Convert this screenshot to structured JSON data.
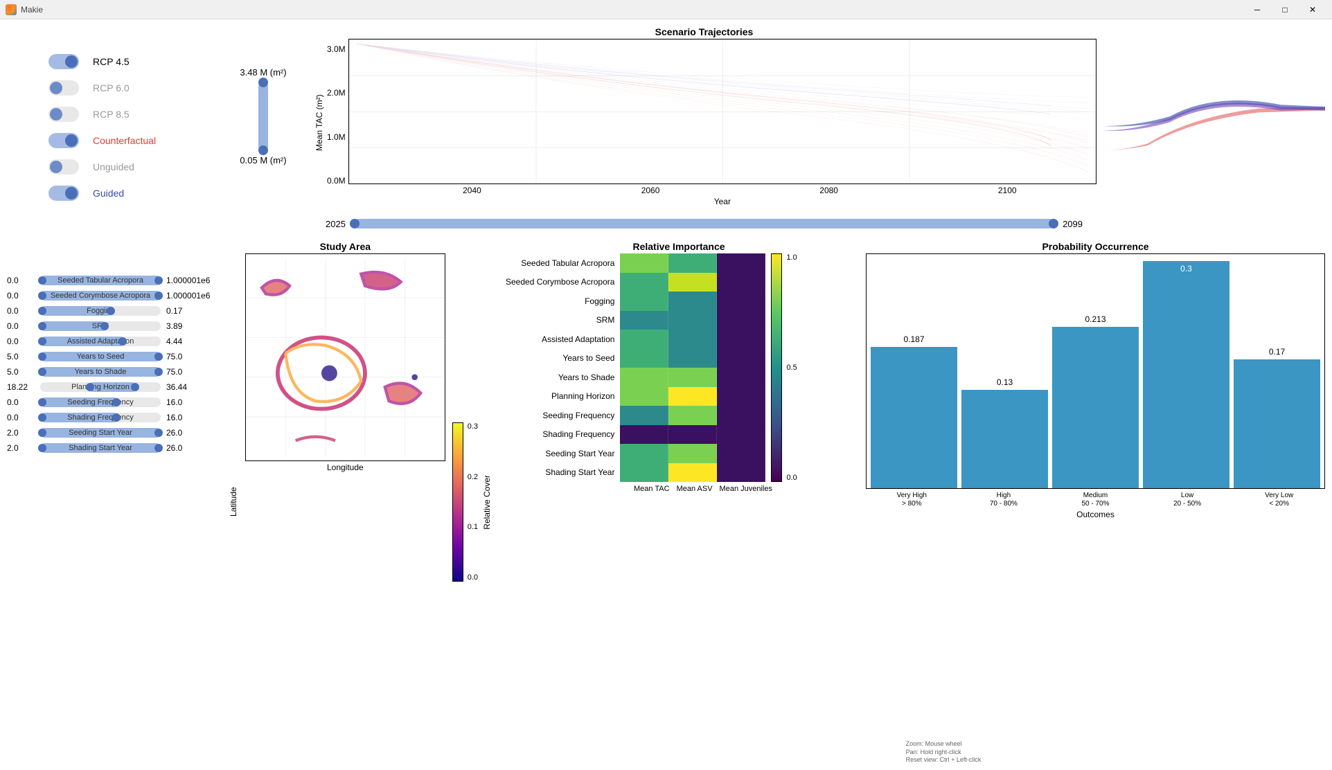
{
  "app": {
    "title": "Makie"
  },
  "toggles": [
    {
      "name": "rcp45",
      "label": "RCP 4.5",
      "on": true,
      "class": ""
    },
    {
      "name": "rcp60",
      "label": "RCP 6.0",
      "on": false,
      "class": "inactive"
    },
    {
      "name": "rcp85",
      "label": "RCP 8.5",
      "on": false,
      "class": "inactive"
    },
    {
      "name": "counterfactual",
      "label": "Counterfactual",
      "on": true,
      "class": "active-red"
    },
    {
      "name": "unguided",
      "label": "Unguided",
      "on": false,
      "class": "inactive"
    },
    {
      "name": "guided",
      "label": "Guided",
      "on": true,
      "class": "active-blue"
    }
  ],
  "vslider": {
    "top_label": "3.48 M (m²)",
    "bot_label": "0.05 M (m²)"
  },
  "year_slider": {
    "min": "2025",
    "max": "2099"
  },
  "params": [
    {
      "name": "Seeded Tabular Acropora",
      "min": "0.0",
      "max": "1.000001e6",
      "fill_l": 0,
      "fill_w": 100
    },
    {
      "name": "Seeded Corymbose Acropora",
      "min": "0.0",
      "max": "1.000001e6",
      "fill_l": 0,
      "fill_w": 100
    },
    {
      "name": "Fogging",
      "min": "0.0",
      "max": "0.17",
      "fill_l": 0,
      "fill_w": 60
    },
    {
      "name": "SRM",
      "min": "0.0",
      "max": "3.89",
      "fill_l": 0,
      "fill_w": 55
    },
    {
      "name": "Assisted Adaptation",
      "min": "0.0",
      "max": "4.44",
      "fill_l": 0,
      "fill_w": 70
    },
    {
      "name": "Years to Seed",
      "min": "5.0",
      "max": "75.0",
      "fill_l": 0,
      "fill_w": 100
    },
    {
      "name": "Years to Shade",
      "min": "5.0",
      "max": "75.0",
      "fill_l": 0,
      "fill_w": 100
    },
    {
      "name": "Planning Horizon",
      "min": "18.22",
      "max": "36.44",
      "fill_l": 40,
      "fill_w": 40
    },
    {
      "name": "Seeding Frequency",
      "min": "0.0",
      "max": "16.0",
      "fill_l": 0,
      "fill_w": 65
    },
    {
      "name": "Shading Frequency",
      "min": "0.0",
      "max": "16.0",
      "fill_l": 0,
      "fill_w": 65
    },
    {
      "name": "Seeding Start Year",
      "min": "2.0",
      "max": "26.0",
      "fill_l": 0,
      "fill_w": 100
    },
    {
      "name": "Shading Start Year",
      "min": "2.0",
      "max": "26.0",
      "fill_l": 0,
      "fill_w": 100
    }
  ],
  "chart_data": {
    "trajectory": {
      "type": "line",
      "title": "Scenario Trajectories",
      "xlabel": "Year",
      "ylabel": "Mean TAC (m²)",
      "x_ticks": [
        "2040",
        "2060",
        "2080",
        "2100"
      ],
      "y_ticks": [
        "3.0M",
        "2.0M",
        "1.0M",
        "0.0M"
      ],
      "xlim": [
        2025,
        2099
      ],
      "ylim": [
        0,
        3500000
      ],
      "series_sample": {
        "x": [
          2025,
          2030,
          2040,
          2050,
          2060,
          2070,
          2080,
          2090,
          2099
        ],
        "counterfactual_median": [
          3450000,
          3100000,
          2650000,
          2350000,
          2100000,
          1850000,
          1600000,
          1350000,
          1100000
        ],
        "guided_median": [
          3450000,
          3150000,
          2750000,
          2500000,
          2300000,
          2150000,
          2000000,
          1850000,
          1700000
        ]
      },
      "note": "ensemble of many translucent red (counterfactual) and blue/purple (guided) trajectories"
    },
    "density": {
      "type": "area",
      "note": "final-timestep density; blue/purple peak ~2.0M, red peak ~1.1M, both on same axis",
      "y_range": [
        0,
        3500000
      ]
    },
    "map": {
      "type": "scatter",
      "title": "Study Area",
      "xlabel": "Longitude",
      "ylabel": "Latitude",
      "colorbar_label": "Relative Cover",
      "colorbar_ticks": [
        "0.3",
        "0.2",
        "0.1",
        "0.0"
      ]
    },
    "heatmap": {
      "type": "heatmap",
      "title": "Relative Importance",
      "y": [
        "Seeded Tabular Acropora",
        "Seeded Corymbose Acropora",
        "Fogging",
        "SRM",
        "Assisted Adaptation",
        "Years to Seed",
        "Years to Shade",
        "Planning Horizon",
        "Seeding Frequency",
        "Shading Frequency",
        "Seeding Start Year",
        "Shading Start Year"
      ],
      "x": [
        "Mean TAC",
        "Mean ASV",
        "Mean Juveniles"
      ],
      "z": [
        [
          0.55,
          0.5,
          0.05
        ],
        [
          0.5,
          0.85,
          0.05
        ],
        [
          0.45,
          0.3,
          0.05
        ],
        [
          0.35,
          0.35,
          0.05
        ],
        [
          0.48,
          0.4,
          0.05
        ],
        [
          0.5,
          0.4,
          0.05
        ],
        [
          0.55,
          0.65,
          0.05
        ],
        [
          0.55,
          0.95,
          0.05
        ],
        [
          0.35,
          0.55,
          0.05
        ],
        [
          0.02,
          0.02,
          0.02
        ],
        [
          0.5,
          0.55,
          0.05
        ],
        [
          0.5,
          0.95,
          0.05
        ]
      ],
      "colorbar_ticks": [
        "1.0",
        "0.5",
        "0.0"
      ]
    },
    "probability": {
      "type": "bar",
      "title": "Probability Occurrence",
      "xlabel": "Outcomes",
      "categories": [
        "Very High\n> 80%",
        "High\n70 - 80%",
        "Medium\n50 - 70%",
        "Low\n20 - 50%",
        "Very Low\n< 20%"
      ],
      "values": [
        0.187,
        0.13,
        0.213,
        0.3,
        0.17
      ]
    }
  },
  "help": {
    "zoom": "Zoom: Mouse wheel",
    "pan": "Pan: Hold right-click",
    "reset": "Reset view: Ctrl + Left-click"
  }
}
